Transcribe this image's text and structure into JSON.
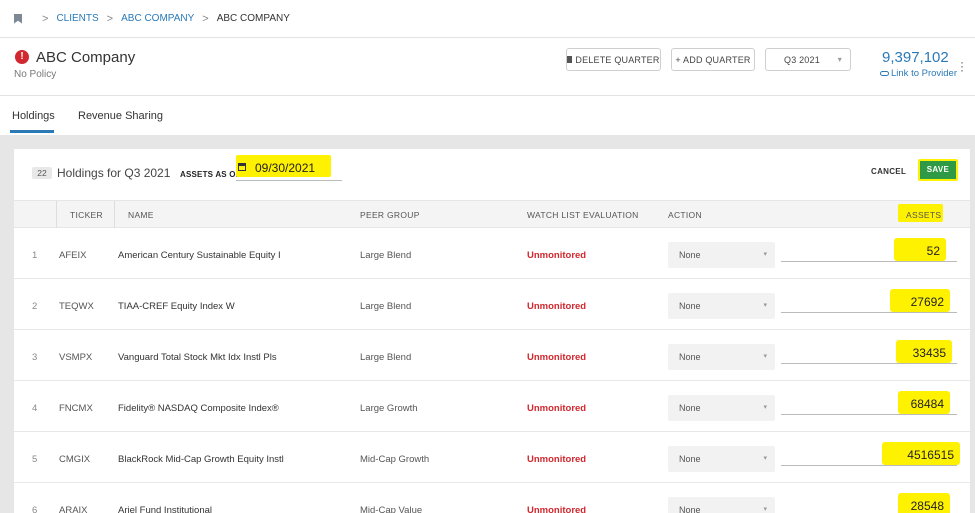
{
  "breadcrumb": {
    "items": [
      "CLIENTS",
      "ABC COMPANY",
      "ABC COMPANY"
    ],
    "separator": ">"
  },
  "header": {
    "alert_glyph": "!",
    "company_name": "ABC Company",
    "policy": "No Policy",
    "delete_quarter_label": "DELETE QUARTER",
    "add_quarter_label": "+ ADD QUARTER",
    "quarter_selected": "Q3 2021",
    "total_assets": "9,397,102",
    "link_provider": "Link to Provider"
  },
  "tabs": [
    {
      "label": "Holdings",
      "active": true
    },
    {
      "label": "Revenue Sharing",
      "active": false
    }
  ],
  "holdings": {
    "count": "22",
    "title": "Holdings for Q3 2021",
    "assets_as_of_label": "ASSETS AS OF",
    "assets_as_of_date": "09/30/2021",
    "cancel_label": "CANCEL",
    "save_label": "SAVE",
    "columns": [
      "TICKER",
      "NAME",
      "PEER GROUP",
      "WATCH LIST EVALUATION",
      "ACTION",
      "ASSETS"
    ],
    "rows": [
      {
        "index": "1",
        "ticker": "AFEIX",
        "name": "American Century Sustainable Equity I",
        "peer_group": "Large Blend",
        "watch": "Unmonitored",
        "action": "None",
        "assets": "52"
      },
      {
        "index": "2",
        "ticker": "TEQWX",
        "name": "TIAA-CREF Equity Index W",
        "peer_group": "Large Blend",
        "watch": "Unmonitored",
        "action": "None",
        "assets": "27692"
      },
      {
        "index": "3",
        "ticker": "VSMPX",
        "name": "Vanguard Total Stock Mkt Idx Instl Pls",
        "peer_group": "Large Blend",
        "watch": "Unmonitored",
        "action": "None",
        "assets": "33435"
      },
      {
        "index": "4",
        "ticker": "FNCMX",
        "name": "Fidelity® NASDAQ Composite Index®",
        "peer_group": "Large Growth",
        "watch": "Unmonitored",
        "action": "None",
        "assets": "68484"
      },
      {
        "index": "5",
        "ticker": "CMGIX",
        "name": "BlackRock Mid-Cap Growth Equity Instl",
        "peer_group": "Mid-Cap Growth",
        "watch": "Unmonitored",
        "action": "None",
        "assets": "4516515"
      },
      {
        "index": "6",
        "ticker": "ARAIX",
        "name": "Ariel Fund Institutional",
        "peer_group": "Mid-Cap Value",
        "watch": "Unmonitored",
        "action": "None",
        "assets": "28548"
      }
    ]
  },
  "colors": {
    "accent": "#2a7ab8",
    "alert": "#d0282e",
    "save": "#2e9a45",
    "highlight": "#fff200"
  }
}
